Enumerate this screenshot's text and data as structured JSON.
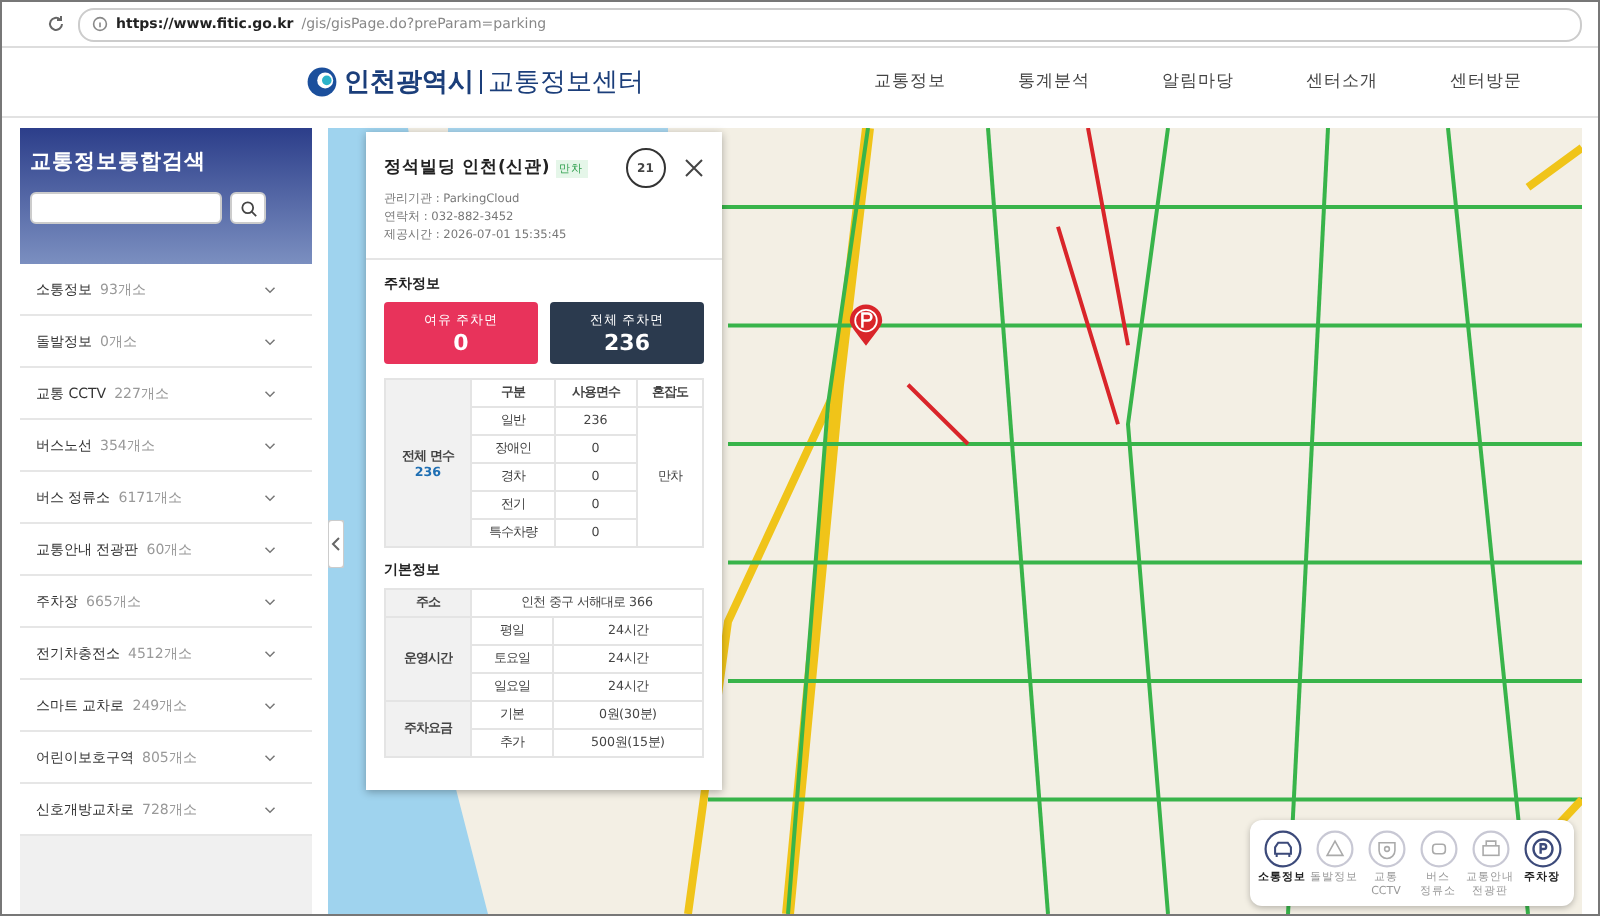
{
  "browser": {
    "url_host": "https://www.fitic.go.kr",
    "url_path": "/gis/gisPage.do?preParam=parking"
  },
  "header": {
    "logo_city": "인천광역시",
    "logo_center": "교통정보센터",
    "nav": [
      "교통정보",
      "통계분석",
      "알림마당",
      "센터소개",
      "센터방문"
    ]
  },
  "sidebar": {
    "title": "교통정보통합검색",
    "items": [
      {
        "name": "소통정보",
        "count": "93개소"
      },
      {
        "name": "돌발정보",
        "count": "0개소"
      },
      {
        "name": "교통 CCTV",
        "count": "227개소"
      },
      {
        "name": "버스노선",
        "count": "354개소"
      },
      {
        "name": "버스 정류소",
        "count": "6171개소"
      },
      {
        "name": "교통안내 전광판",
        "count": "60개소"
      },
      {
        "name": "주차장",
        "count": "665개소"
      },
      {
        "name": "전기차충전소",
        "count": "4512개소"
      },
      {
        "name": "스마트 교차로",
        "count": "249개소"
      },
      {
        "name": "어린이보호구역",
        "count": "805개소"
      },
      {
        "name": "신호개방교차로",
        "count": "728개소"
      }
    ]
  },
  "popup": {
    "title": "정석빌딩 인천(신관)",
    "badge": "만차",
    "icon_number": "21",
    "info": [
      "관리기관 : ParkingCloud",
      "연락처 : 032-882-3452",
      "제공시간 : 2026-07-01 15:35:45"
    ],
    "parking_section": "주차정보",
    "cards": [
      {
        "kind": "available",
        "label": "여유 주차면",
        "value": "0"
      },
      {
        "kind": "total",
        "label": "전체 주차면",
        "value": "236"
      }
    ],
    "usage": {
      "total_label": "전체 면수",
      "total_value": "236",
      "columns": [
        "구분",
        "사용면수",
        "혼잡도"
      ],
      "congestion": "만차",
      "rows": [
        {
          "type": "일반",
          "used": "236"
        },
        {
          "type": "장애인",
          "used": "0"
        },
        {
          "type": "경차",
          "used": "0"
        },
        {
          "type": "전기",
          "used": "0"
        },
        {
          "type": "특수차량",
          "used": "0"
        }
      ]
    },
    "basic_section": "기본정보",
    "address": {
      "label": "주소",
      "value": "인천 중구 서해대로 366"
    },
    "hours": {
      "label": "운영시간",
      "rows": [
        {
          "day": "평일",
          "value": "24시간"
        },
        {
          "day": "토요일",
          "value": "24시간"
        },
        {
          "day": "일요일",
          "value": "24시간"
        }
      ]
    },
    "fee": {
      "label": "주차요금",
      "rows": [
        {
          "day": "기본",
          "value": "0원(30분)"
        },
        {
          "day": "추가",
          "value": "500원(15분)"
        }
      ]
    }
  },
  "legend": [
    {
      "kind": "traffic",
      "lines": [
        "소통정보"
      ],
      "selected": true
    },
    {
      "kind": "incident",
      "lines": [
        "돌발정보"
      ],
      "selected": false
    },
    {
      "kind": "cctv",
      "lines": [
        "교통",
        "CCTV"
      ],
      "selected": false
    },
    {
      "kind": "bus",
      "lines": [
        "버스",
        "정류소"
      ],
      "selected": false
    },
    {
      "kind": "sign",
      "lines": [
        "교통안내",
        "전광판"
      ],
      "selected": false
    },
    {
      "kind": "parking",
      "lines": [
        "주차장"
      ],
      "selected": true
    }
  ]
}
